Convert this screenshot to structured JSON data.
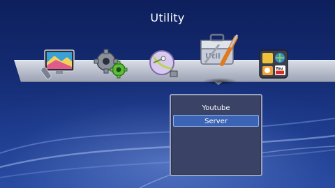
{
  "header": {
    "title": "Utility"
  },
  "toolbar": {
    "icons": [
      {
        "name": "tv-remote-icon"
      },
      {
        "name": "settings-gears-icon"
      },
      {
        "name": "satellite-dish-icon"
      },
      {
        "name": "utility-toolbox-icon",
        "selected": true
      },
      {
        "name": "apps-grid-icon"
      }
    ]
  },
  "submenu": {
    "items": [
      {
        "label": "Youtube",
        "selected": false
      },
      {
        "label": "Server",
        "selected": true
      }
    ]
  }
}
